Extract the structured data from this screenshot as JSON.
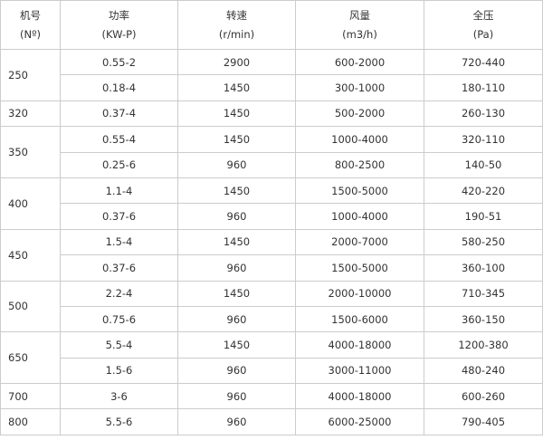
{
  "headers": [
    {
      "name": "机号",
      "unit": "(Nº)"
    },
    {
      "name": "功率",
      "unit": "(KW-P)"
    },
    {
      "name": "转速",
      "unit": "(r/min)"
    },
    {
      "name": "风量",
      "unit": "(m3/h)"
    },
    {
      "name": "全压",
      "unit": "(Pa)"
    }
  ],
  "models": [
    {
      "model": "250",
      "rows": [
        {
          "power": "0.55-2",
          "speed": "2900",
          "flow": "600-2000",
          "pressure": "720-440"
        },
        {
          "power": "0.18-4",
          "speed": "1450",
          "flow": "300-1000",
          "pressure": "180-110"
        }
      ]
    },
    {
      "model": "320",
      "rows": [
        {
          "power": "0.37-4",
          "speed": "1450",
          "flow": "500-2000",
          "pressure": "260-130"
        }
      ]
    },
    {
      "model": "350",
      "rows": [
        {
          "power": "0.55-4",
          "speed": "1450",
          "flow": "1000-4000",
          "pressure": "320-110"
        },
        {
          "power": "0.25-6",
          "speed": "960",
          "flow": "800-2500",
          "pressure": "140-50"
        }
      ]
    },
    {
      "model": "400",
      "rows": [
        {
          "power": "1.1-4",
          "speed": "1450",
          "flow": "1500-5000",
          "pressure": "420-220"
        },
        {
          "power": "0.37-6",
          "speed": "960",
          "flow": "1000-4000",
          "pressure": "190-51"
        }
      ]
    },
    {
      "model": "450",
      "rows": [
        {
          "power": "1.5-4",
          "speed": "1450",
          "flow": "2000-7000",
          "pressure": "580-250"
        },
        {
          "power": "0.37-6",
          "speed": "960",
          "flow": "1500-5000",
          "pressure": "360-100"
        }
      ]
    },
    {
      "model": "500",
      "rows": [
        {
          "power": "2.2-4",
          "speed": "1450",
          "flow": "2000-10000",
          "pressure": "710-345"
        },
        {
          "power": "0.75-6",
          "speed": "960",
          "flow": "1500-6000",
          "pressure": "360-150"
        }
      ]
    },
    {
      "model": "650",
      "rows": [
        {
          "power": "5.5-4",
          "speed": "1450",
          "flow": "4000-18000",
          "pressure": "1200-380"
        },
        {
          "power": "1.5-6",
          "speed": "960",
          "flow": "3000-11000",
          "pressure": "480-240"
        }
      ]
    },
    {
      "model": "700",
      "rows": [
        {
          "power": "3-6",
          "speed": "960",
          "flow": "4000-18000",
          "pressure": "600-260"
        }
      ]
    },
    {
      "model": "800",
      "rows": [
        {
          "power": "5.5-6",
          "speed": "960",
          "flow": "6000-25000",
          "pressure": "790-405"
        }
      ]
    }
  ]
}
